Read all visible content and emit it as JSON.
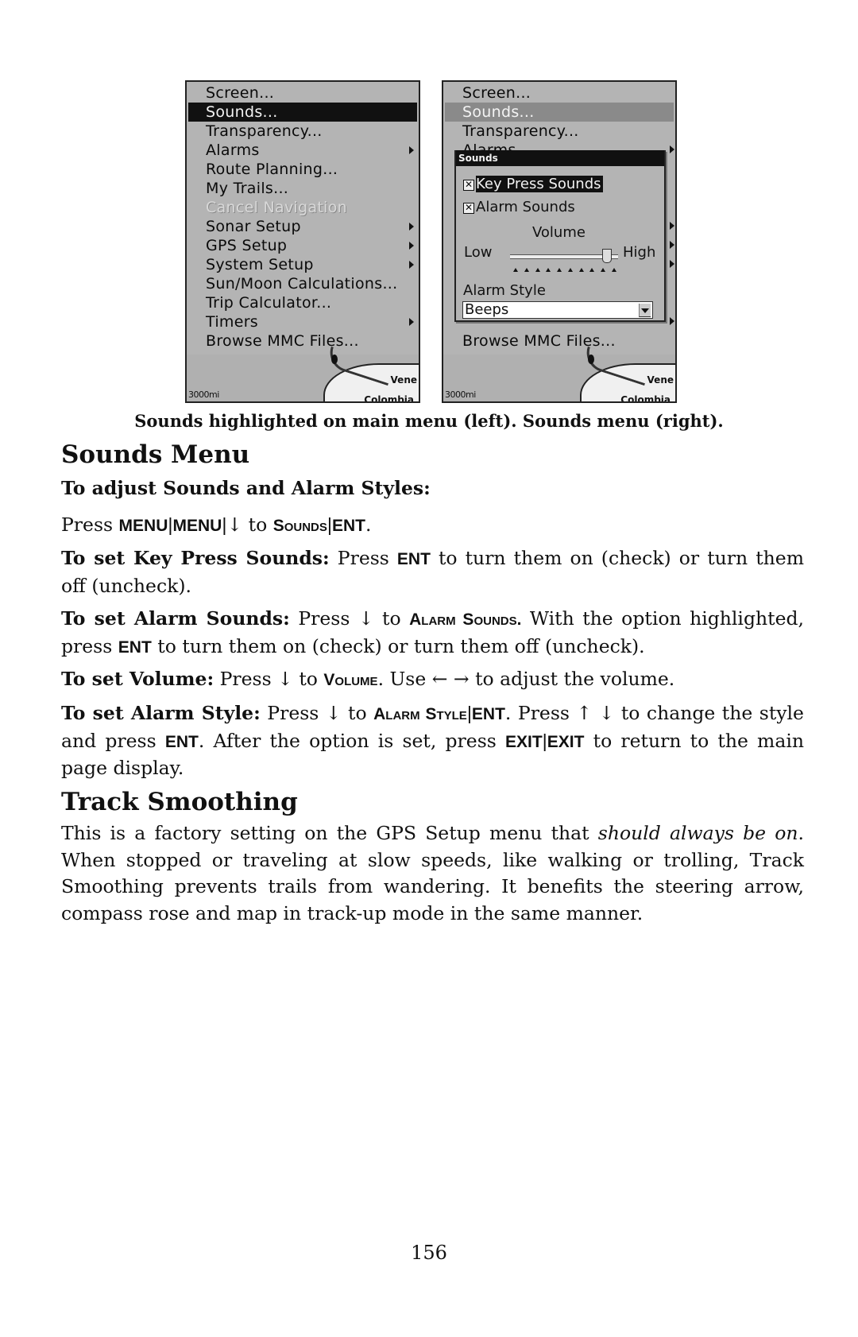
{
  "left_screenshot": {
    "menu_items": [
      {
        "label": "Screen...",
        "state": "normal",
        "submenu": false
      },
      {
        "label": "Sounds...",
        "state": "selected",
        "submenu": false
      },
      {
        "label": "Transparency...",
        "state": "normal",
        "submenu": false
      },
      {
        "label": "Alarms",
        "state": "normal",
        "submenu": true
      },
      {
        "label": "Route Planning...",
        "state": "normal",
        "submenu": false
      },
      {
        "label": "My Trails...",
        "state": "normal",
        "submenu": false
      },
      {
        "label": "Cancel Navigation",
        "state": "disabled",
        "submenu": false
      },
      {
        "label": "Sonar Setup",
        "state": "normal",
        "submenu": true
      },
      {
        "label": "GPS Setup",
        "state": "normal",
        "submenu": true
      },
      {
        "label": "System Setup",
        "state": "normal",
        "submenu": true
      },
      {
        "label": "Sun/Moon Calculations...",
        "state": "normal",
        "submenu": false
      },
      {
        "label": "Trip Calculator...",
        "state": "normal",
        "submenu": false
      },
      {
        "label": "Timers",
        "state": "normal",
        "submenu": true
      },
      {
        "label": "Browse MMC Files...",
        "state": "normal",
        "submenu": false
      }
    ],
    "map": {
      "scale": "3000mi",
      "labels": [
        "Vene",
        "Colombia"
      ]
    }
  },
  "right_screenshot": {
    "menu_items": [
      {
        "label": "Screen...",
        "state": "normal"
      },
      {
        "label": "Sounds...",
        "state": "selected-dim"
      },
      {
        "label": "Transparency...",
        "state": "normal"
      },
      {
        "label": "Alarms",
        "state": "normal"
      },
      {
        "label": "Browse MMC Files...",
        "state": "normal"
      }
    ],
    "dialog": {
      "title": "Sounds",
      "key_press_sounds": {
        "label": "Key Press Sounds",
        "checked": true,
        "check_glyph": "✕"
      },
      "alarm_sounds": {
        "label": "Alarm Sounds",
        "checked": true,
        "check_glyph": "✕"
      },
      "volume": {
        "title": "Volume",
        "low_label": "Low",
        "high_label": "High",
        "level_fraction": 0.9,
        "tick_count": 10
      },
      "alarm_style": {
        "label": "Alarm Style",
        "selected": "Beeps"
      }
    },
    "map": {
      "scale": "3000mi",
      "labels": [
        "Vene",
        "Colombia"
      ]
    }
  },
  "caption": "Sounds highlighted on main menu (left). Sounds menu (right).",
  "sounds_menu": {
    "heading": "Sounds Menu",
    "subheading": "To adjust Sounds and Alarm Styles:",
    "press_line": {
      "press": "Press ",
      "k1": "MENU",
      "sep": "|",
      "k2": "MENU",
      "arrow": "↓",
      "to": " to ",
      "k3": "Sounds",
      "k4": "ENT",
      "end": "."
    },
    "key_press": {
      "label": "To set Key Press Sounds:",
      "t1": " Press ",
      "k1": "ENT",
      "t2": " to turn them on (check) or turn them off (uncheck)."
    },
    "alarm_sounds": {
      "label": "To set Alarm Sounds:",
      "t1": " Press ",
      "arrow": "↓",
      "t2": " to ",
      "k1": "Alarm Sounds.",
      "t3": " With the option high­lighted, press ",
      "k2": "ENT",
      "t4": " to turn them on (check) or turn them off (uncheck)."
    },
    "volume": {
      "label": "To set Volume:",
      "t1": " Press ",
      "arrow": "↓",
      "t2": " to ",
      "k1": "Volume",
      "t3": ". Use ",
      "arrows": "← →",
      "t4": " to adjust the volume."
    },
    "alarm_style": {
      "label": "To set Alarm Style:",
      "t1": " Press ",
      "arrow": "↓",
      "t2": " to ",
      "k1": "Alarm Style",
      "sep": "|",
      "k2": "ENT",
      "t3": ". Press ",
      "arrows": "↑ ↓",
      "t4": " to change the style and press ",
      "k3": "ENT",
      "t5": ". After the option is set, press ",
      "k4": "EXIT",
      "k5": "EXIT",
      "t6": " to re­turn to the main page display."
    }
  },
  "track_smoothing": {
    "heading": "Track Smoothing",
    "t1": "This is a factory setting on the GPS Setup menu that ",
    "em": "should always be on",
    "t2": ". When stopped or traveling at slow speeds, like walking or trolling, Track Smoothing prevents trails from wandering. It benefits the steer­ing arrow, compass rose and map in track-up mode in the same man­ner."
  },
  "page_number": "156"
}
